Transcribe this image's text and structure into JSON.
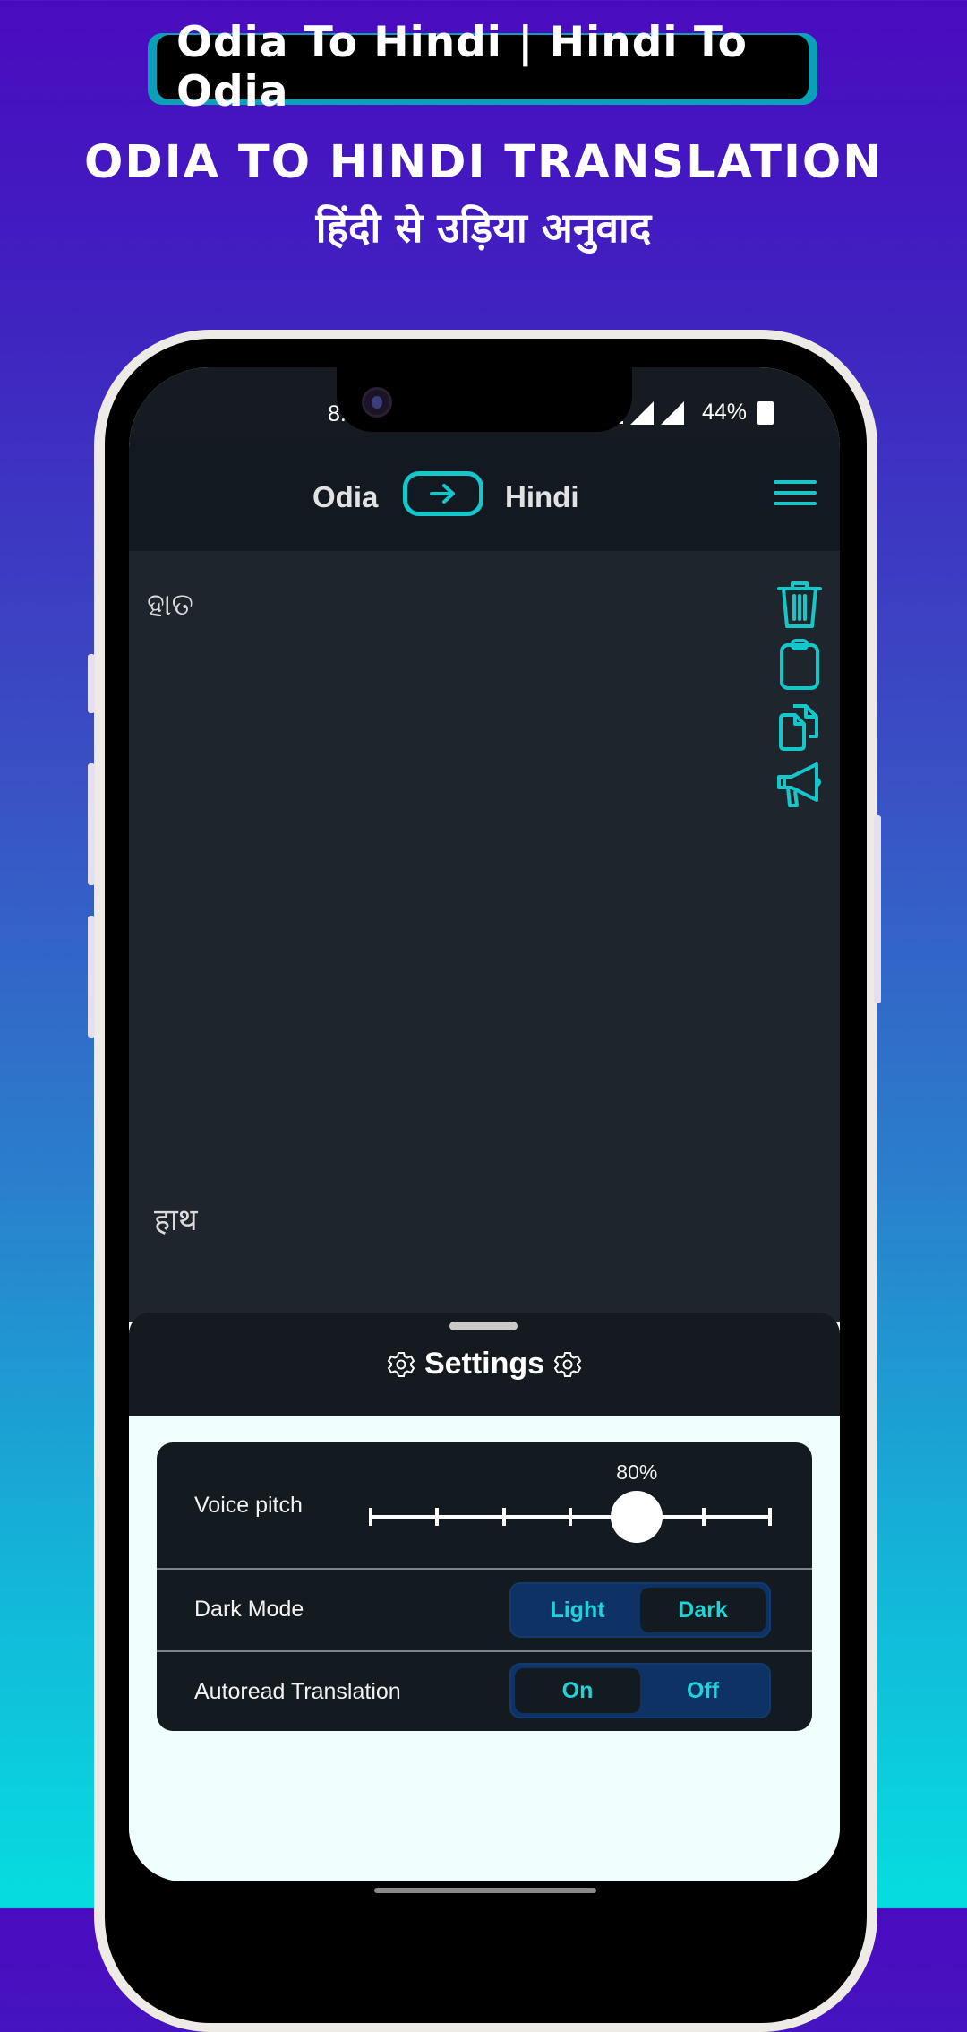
{
  "banner": {
    "title": "Odia To Hindi | Hindi To Odia",
    "headline": "ODIA TO HINDI TRANSLATION",
    "subheadline": "हिंदी से उड़िया अनुवाद"
  },
  "status_bar": {
    "time": "8.",
    "battery": "44%",
    "icons": [
      "sim-2-icon",
      "signal-icon",
      "signal-icon",
      "battery-icon"
    ]
  },
  "header": {
    "source_language": "Odia",
    "target_language": "Hindi",
    "swap_icon": "arrow-right-icon",
    "menu_icon": "hamburger-menu-icon"
  },
  "editor": {
    "source_text": "ହାତ",
    "translated_text": "हाथ",
    "tools": [
      {
        "name": "delete",
        "icon": "trash-icon"
      },
      {
        "name": "paste",
        "icon": "clipboard-icon"
      },
      {
        "name": "copy",
        "icon": "copy-icon"
      },
      {
        "name": "speak",
        "icon": "megaphone-icon"
      }
    ]
  },
  "settings": {
    "title": "Settings",
    "voice_pitch": {
      "label": "Voice pitch",
      "value_label": "80%",
      "ticks": 7,
      "selected_tick_index": 4
    },
    "dark_mode": {
      "label": "Dark Mode",
      "options": [
        "Light",
        "Dark"
      ],
      "selected": "Dark"
    },
    "autoread": {
      "label": "Autoread Translation",
      "options": [
        "On",
        "Off"
      ],
      "selected": "On"
    }
  },
  "colors": {
    "accent": "#16c7c9",
    "segment_bg": "#0d3263",
    "panel_bg": "#131a20",
    "editor_bg": "#1e252c"
  }
}
